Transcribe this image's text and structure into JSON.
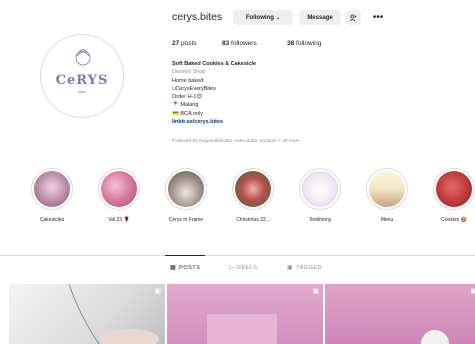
{
  "profile": {
    "username": "cerys.bites",
    "avatar_text": "CeRYS",
    "avatar_sub": "bites",
    "buttons": {
      "following": "Following",
      "message": "Message"
    },
    "stats": {
      "posts_count": "27",
      "posts_label": "posts",
      "followers_count": "83",
      "followers_label": "followers",
      "following_count": "38",
      "following_label": "following"
    },
    "bio": {
      "name": "Soft Baked Cookies & Cakesicle",
      "category": "Dessert Shop",
      "lines": [
        "Home baked",
        "□CerysEveryBites",
        "Order H-1😊",
        "📍 Malang",
        "💳 BCA only"
      ],
      "link": "linktr.ee/cerys.bites"
    },
    "followed_by": "Followed by eugeniafelicitas, ester.ardi8, lordanin + 39 more"
  },
  "highlights": [
    {
      "label": "Cakesicles",
      "color": "#b98aa7"
    },
    {
      "label": "Val 23 🌹",
      "color": "#d77a9e"
    },
    {
      "label": "Cerys In Frame",
      "color": "#9c8d84"
    },
    {
      "label": "Christmas 22...",
      "color": "#b44f4f"
    },
    {
      "label": "Testimony",
      "color": "#d8c7e8"
    },
    {
      "label": "Menu",
      "color": "#f1e6c6"
    },
    {
      "label": "Cookies 🍪",
      "color": "#c23d3d"
    }
  ],
  "tabs": [
    {
      "label": "POSTS",
      "active": true,
      "icon": "grid-icon"
    },
    {
      "label": "REELS",
      "active": false,
      "icon": "reels-icon"
    },
    {
      "label": "TAGGED",
      "active": false,
      "icon": "tagged-icon"
    }
  ],
  "colors": {
    "accent_purple": "#8a6fb5",
    "button_bg": "#efefef",
    "link": "#00376b",
    "muted": "#8e8e8e"
  }
}
